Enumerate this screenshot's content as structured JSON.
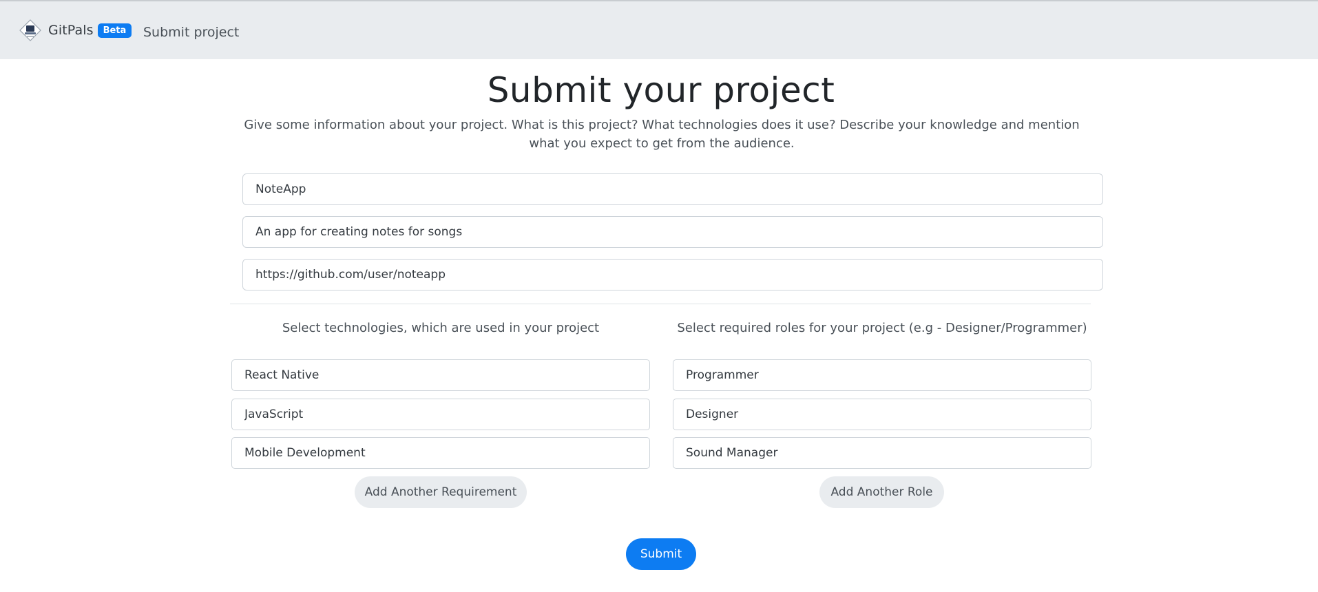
{
  "header": {
    "brand_name": "GitPals",
    "beta_badge": "Beta",
    "nav_link": "Submit project"
  },
  "main": {
    "title": "Submit your project",
    "intro": "Give some information about your project. What is this project? What technologies does it use? Describe your knowledge and mention what you expect to get from the audience.",
    "project_name": "NoteApp",
    "project_description": "An app for creating notes for songs",
    "repo_url": "https://github.com/user/noteapp"
  },
  "technologies": {
    "heading": "Select technologies, which are used in your project",
    "items": [
      "React Native",
      "JavaScript",
      "Mobile Development"
    ],
    "add_button": "Add Another Requirement"
  },
  "roles": {
    "heading": "Select required roles for your project (e.g - Designer/Programmer)",
    "items": [
      "Programmer",
      "Designer",
      "Sound Manager"
    ],
    "add_button": "Add Another Role"
  },
  "submit_label": "Submit",
  "colors": {
    "accent": "#0d7cf2",
    "header_bg": "#e9ecef",
    "button_secondary_bg": "#e9ecef"
  }
}
